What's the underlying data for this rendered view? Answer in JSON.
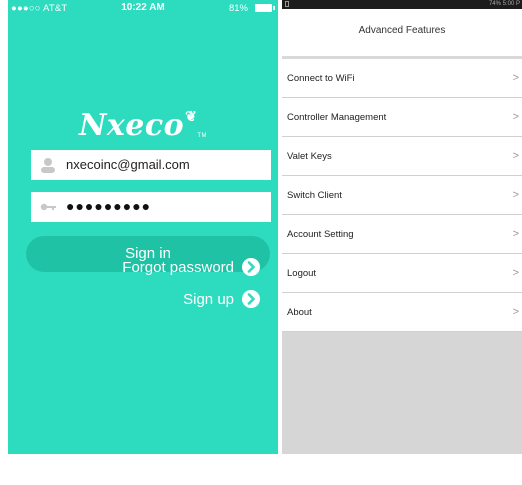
{
  "login": {
    "status_bar": {
      "carrier": "●●●○○ AT&T ",
      "time": "10:22 AM",
      "battery": "81%"
    },
    "logo_text": "Nxeco",
    "logo_tm": "TM",
    "email_value": "nxecoinc@gmail.com",
    "password_masked": "●●●●●●●●●",
    "signin_label": "Sign in",
    "forgot_label": "Forgot password",
    "signup_label": "Sign up"
  },
  "menu": {
    "status_bar": {
      "right_text": "74% 5:00 P"
    },
    "header_title": "Advanced Features",
    "items": [
      {
        "label": "Connect to WiFi"
      },
      {
        "label": "Controller Management"
      },
      {
        "label": "Valet Keys"
      },
      {
        "label": "Switch Client"
      },
      {
        "label": "Account Setting"
      },
      {
        "label": "Logout"
      },
      {
        "label": "About"
      }
    ],
    "chevron": ">"
  },
  "colors": {
    "login_background": "#2ddcbf",
    "signin_button": "#20c2a6",
    "menu_background": "#d6d6d6"
  }
}
